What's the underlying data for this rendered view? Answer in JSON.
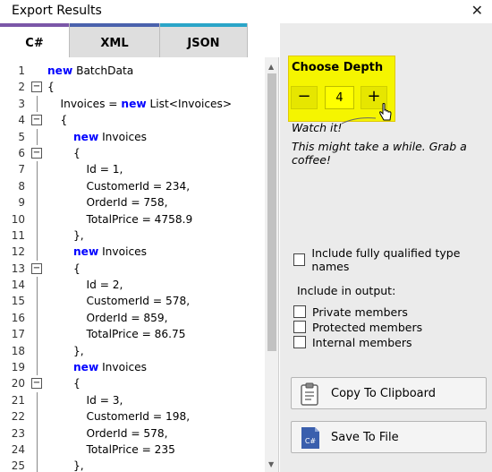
{
  "window": {
    "title": "Export Results",
    "close_glyph": "✕"
  },
  "tabs": [
    {
      "label": "C#",
      "bar_color": "#7b57a8",
      "active": true
    },
    {
      "label": "XML",
      "bar_color": "#4a62ad",
      "active": false
    },
    {
      "label": "JSON",
      "bar_color": "#2aa5c8",
      "active": false
    }
  ],
  "code_lines": [
    {
      "n": "1",
      "indent": 0,
      "fold": "",
      "kw": "new",
      "text": " BatchData"
    },
    {
      "n": "2",
      "indent": 0,
      "fold": "−",
      "kw": "",
      "text": "{"
    },
    {
      "n": "3",
      "indent": 1,
      "fold": "",
      "kw": "",
      "text": "Invoices = ",
      "kw2": "new",
      "text2": " List<Invoices>"
    },
    {
      "n": "4",
      "indent": 1,
      "fold": "−",
      "kw": "",
      "text": "{"
    },
    {
      "n": "5",
      "indent": 2,
      "fold": "",
      "kw": "new",
      "text": " Invoices"
    },
    {
      "n": "6",
      "indent": 2,
      "fold": "−",
      "kw": "",
      "text": "{"
    },
    {
      "n": "7",
      "indent": 3,
      "fold": "",
      "kw": "",
      "text": "Id = 1,"
    },
    {
      "n": "8",
      "indent": 3,
      "fold": "",
      "kw": "",
      "text": "CustomerId = 234,"
    },
    {
      "n": "9",
      "indent": 3,
      "fold": "",
      "kw": "",
      "text": "OrderId = 758,"
    },
    {
      "n": "10",
      "indent": 3,
      "fold": "",
      "kw": "",
      "text": "TotalPrice = 4758.9"
    },
    {
      "n": "11",
      "indent": 2,
      "fold": "",
      "kw": "",
      "text": "},"
    },
    {
      "n": "12",
      "indent": 2,
      "fold": "",
      "kw": "new",
      "text": " Invoices"
    },
    {
      "n": "13",
      "indent": 2,
      "fold": "−",
      "kw": "",
      "text": "{"
    },
    {
      "n": "14",
      "indent": 3,
      "fold": "",
      "kw": "",
      "text": "Id = 2,"
    },
    {
      "n": "15",
      "indent": 3,
      "fold": "",
      "kw": "",
      "text": "CustomerId = 578,"
    },
    {
      "n": "16",
      "indent": 3,
      "fold": "",
      "kw": "",
      "text": "OrderId = 859,"
    },
    {
      "n": "17",
      "indent": 3,
      "fold": "",
      "kw": "",
      "text": "TotalPrice = 86.75"
    },
    {
      "n": "18",
      "indent": 2,
      "fold": "",
      "kw": "",
      "text": "},"
    },
    {
      "n": "19",
      "indent": 2,
      "fold": "",
      "kw": "new",
      "text": " Invoices"
    },
    {
      "n": "20",
      "indent": 2,
      "fold": "−",
      "kw": "",
      "text": "{"
    },
    {
      "n": "21",
      "indent": 3,
      "fold": "",
      "kw": "",
      "text": "Id = 3,"
    },
    {
      "n": "22",
      "indent": 3,
      "fold": "",
      "kw": "",
      "text": "CustomerId = 198,"
    },
    {
      "n": "23",
      "indent": 3,
      "fold": "",
      "kw": "",
      "text": "OrderId = 578,"
    },
    {
      "n": "24",
      "indent": 3,
      "fold": "",
      "kw": "",
      "text": "TotalPrice = 235"
    },
    {
      "n": "25",
      "indent": 2,
      "fold": "",
      "kw": "",
      "text": "},"
    }
  ],
  "depth": {
    "label": "Choose Depth",
    "minus": "−",
    "plus": "+",
    "value": "4",
    "watch_text": "Watch it!",
    "hint_text": "This might take a while. Grab a coffee!"
  },
  "options": {
    "fully_qualified": "Include fully qualified type names",
    "include_label": "Include in output:",
    "private": "Private members",
    "protected": "Protected members",
    "internal": "Internal members"
  },
  "buttons": {
    "copy": "Copy To Clipboard",
    "save": "Save To File",
    "file_icon_text": "C#"
  },
  "colors": {
    "accent_yellow": "#f5f500",
    "file_icon_blue": "#3a5fad"
  }
}
